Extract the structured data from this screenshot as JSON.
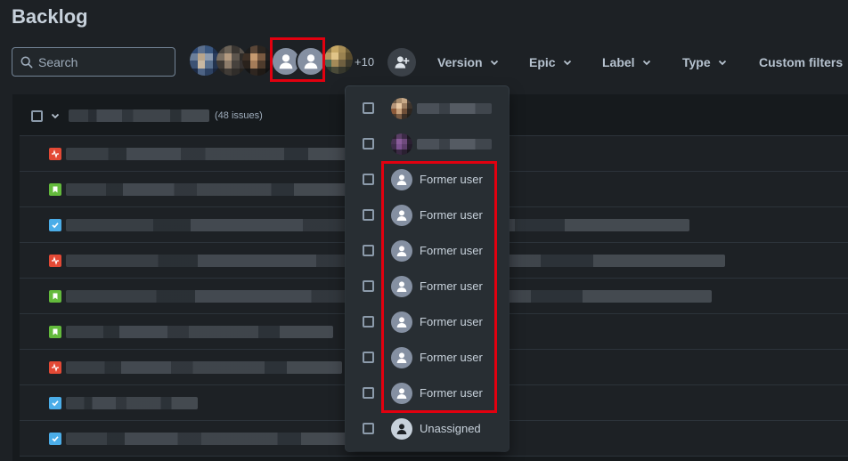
{
  "page": {
    "title": "Backlog"
  },
  "search": {
    "placeholder": "Search",
    "value": ""
  },
  "avatars": {
    "more_count": "+10",
    "add_people_icon": "add-person-icon"
  },
  "filters": [
    {
      "label": "Version"
    },
    {
      "label": "Epic"
    },
    {
      "label": "Label"
    },
    {
      "label": "Type"
    },
    {
      "label": "Custom filters"
    }
  ],
  "backlog": {
    "issue_count": "(48 issues)",
    "rows": [
      {
        "type": "bug"
      },
      {
        "type": "story"
      },
      {
        "type": "task"
      },
      {
        "type": "bug"
      },
      {
        "type": "story"
      },
      {
        "type": "story"
      },
      {
        "type": "bug"
      },
      {
        "type": "task"
      },
      {
        "type": "task"
      }
    ]
  },
  "dropdown": {
    "options": [
      {
        "label": "",
        "kind": "pixelated"
      },
      {
        "label": "",
        "kind": "pixelated"
      },
      {
        "label": "Former user",
        "kind": "former"
      },
      {
        "label": "Former user",
        "kind": "former"
      },
      {
        "label": "Former user",
        "kind": "former"
      },
      {
        "label": "Former user",
        "kind": "former"
      },
      {
        "label": "Former user",
        "kind": "former"
      },
      {
        "label": "Former user",
        "kind": "former"
      },
      {
        "label": "Former user",
        "kind": "former"
      },
      {
        "label": "Unassigned",
        "kind": "unassigned"
      }
    ]
  },
  "colors": {
    "highlight": "#e2000f",
    "bug": "#e34935",
    "story": "#63ba3c",
    "task": "#4bade8"
  }
}
